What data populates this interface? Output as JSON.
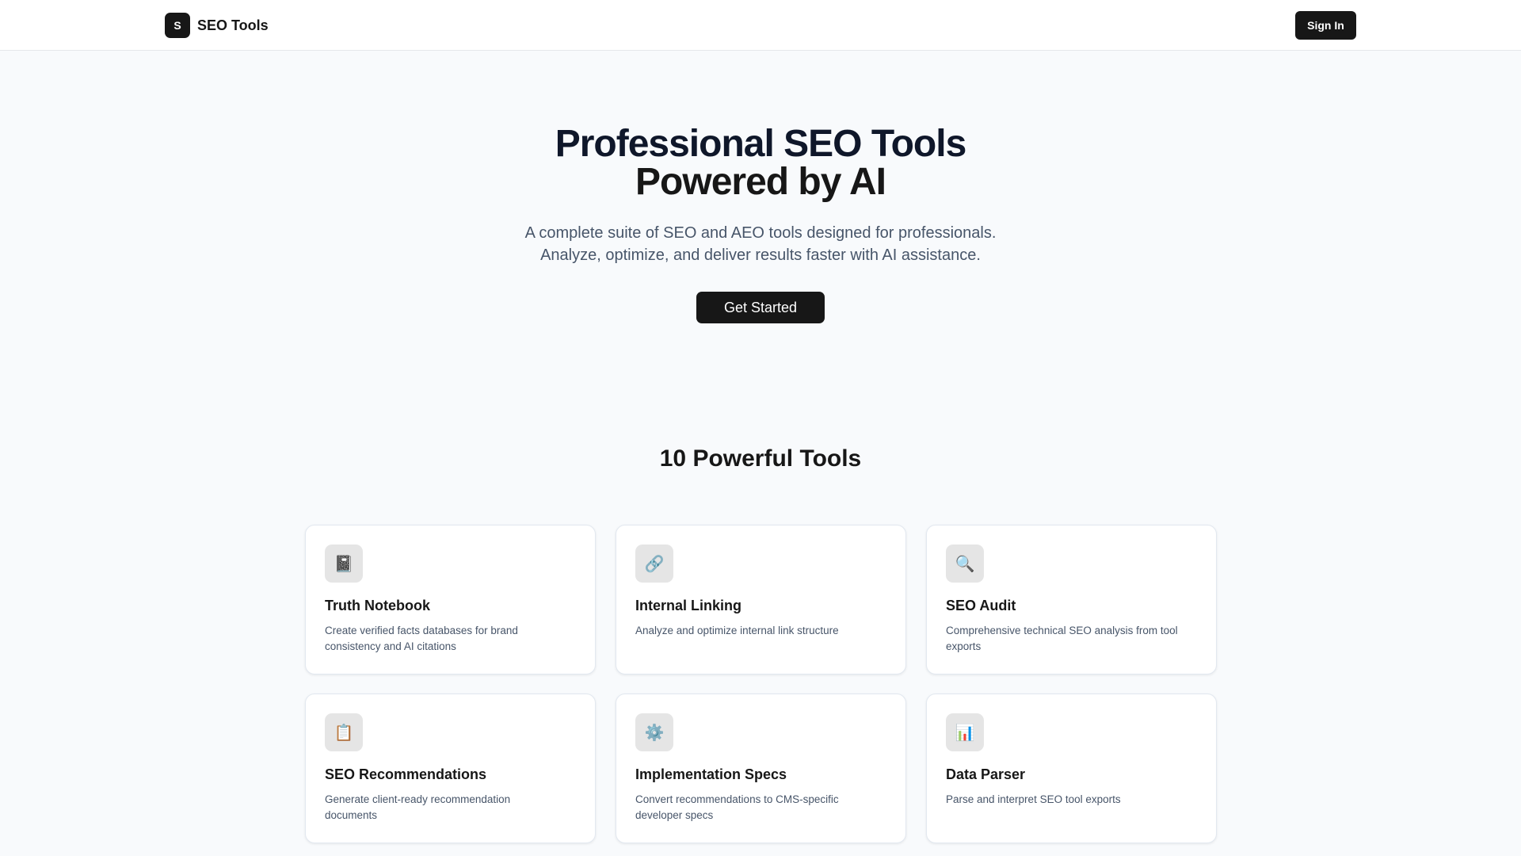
{
  "header": {
    "logo_letter": "S",
    "brand": "SEO Tools",
    "sign_in": "Sign In"
  },
  "hero": {
    "title_line1": "Professional SEO Tools",
    "title_line2": "Powered by AI",
    "subtitle_line1": "A complete suite of SEO and AEO tools designed for professionals.",
    "subtitle_line2": "Analyze, optimize, and deliver results faster with AI assistance.",
    "cta": "Get Started"
  },
  "tools": {
    "title": "10 Powerful Tools",
    "items": [
      {
        "icon": "📓",
        "icon_name": "notebook-icon",
        "name": "Truth Notebook",
        "desc": "Create verified facts databases for brand consistency and AI citations"
      },
      {
        "icon": "🔗",
        "icon_name": "link-icon",
        "name": "Internal Linking",
        "desc": "Analyze and optimize internal link structure"
      },
      {
        "icon": "🔍",
        "icon_name": "magnifier-icon",
        "name": "SEO Audit",
        "desc": "Comprehensive technical SEO analysis from tool exports"
      },
      {
        "icon": "📋",
        "icon_name": "clipboard-icon",
        "name": "SEO Recommendations",
        "desc": "Generate client-ready recommendation documents"
      },
      {
        "icon": "⚙️",
        "icon_name": "gear-icon",
        "name": "Implementation Specs",
        "desc": "Convert recommendations to CMS-specific developer specs"
      },
      {
        "icon": "📊",
        "icon_name": "bar-chart-icon",
        "name": "Data Parser",
        "desc": "Parse and interpret SEO tool exports"
      }
    ]
  }
}
